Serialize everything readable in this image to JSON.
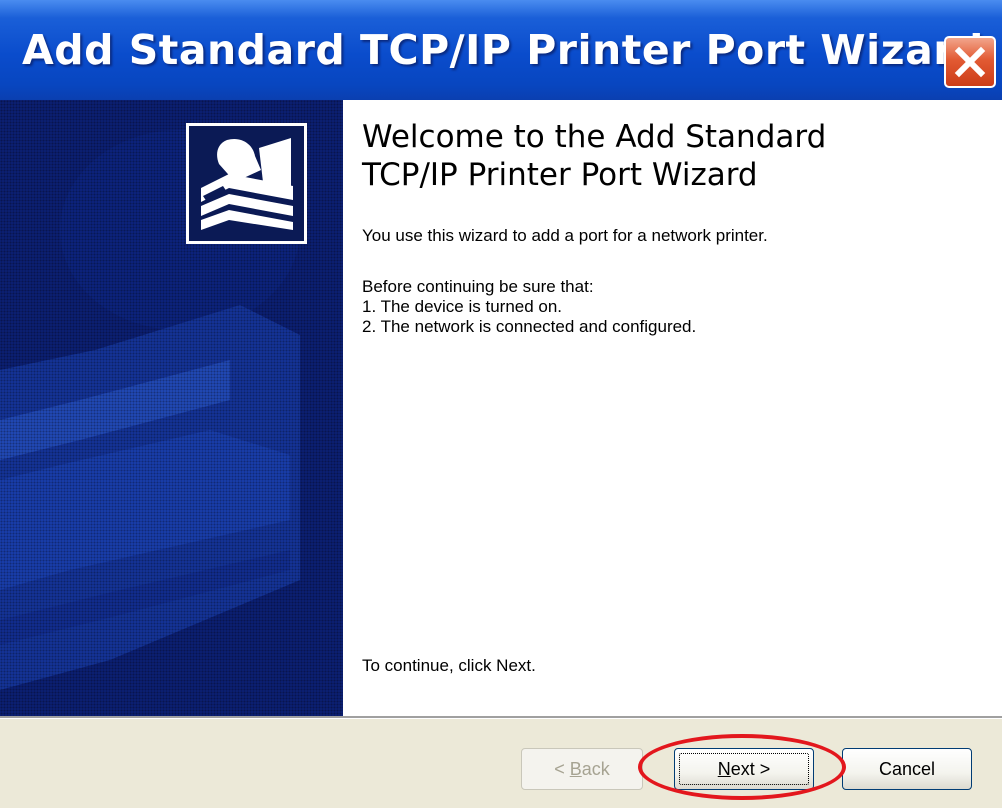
{
  "window": {
    "title": "Add Standard TCP/IP Printer Port Wizard",
    "title_bar_color": "#0a4ccc",
    "close_icon": "close-icon"
  },
  "sidebar": {
    "icon": "printer-wizard-icon",
    "background_color": "#0a1f6e"
  },
  "content": {
    "heading_line1": "Welcome to the Add Standard",
    "heading_line2": "TCP/IP Printer Port Wizard",
    "intro": "You use this wizard to add a port for a network printer.",
    "prereq_heading": "Before continuing be sure that:",
    "prereq_items": [
      "1.  The device is turned on.",
      "2.  The network is connected and configured."
    ],
    "continue_hint": "To continue, click Next."
  },
  "buttons": {
    "back_label": "< Back",
    "back_mnemonic": "B",
    "next_label": "Next >",
    "next_mnemonic": "N",
    "cancel_label": "Cancel"
  },
  "annotation": {
    "highlight_color": "#e3171d",
    "target": "next-button"
  }
}
